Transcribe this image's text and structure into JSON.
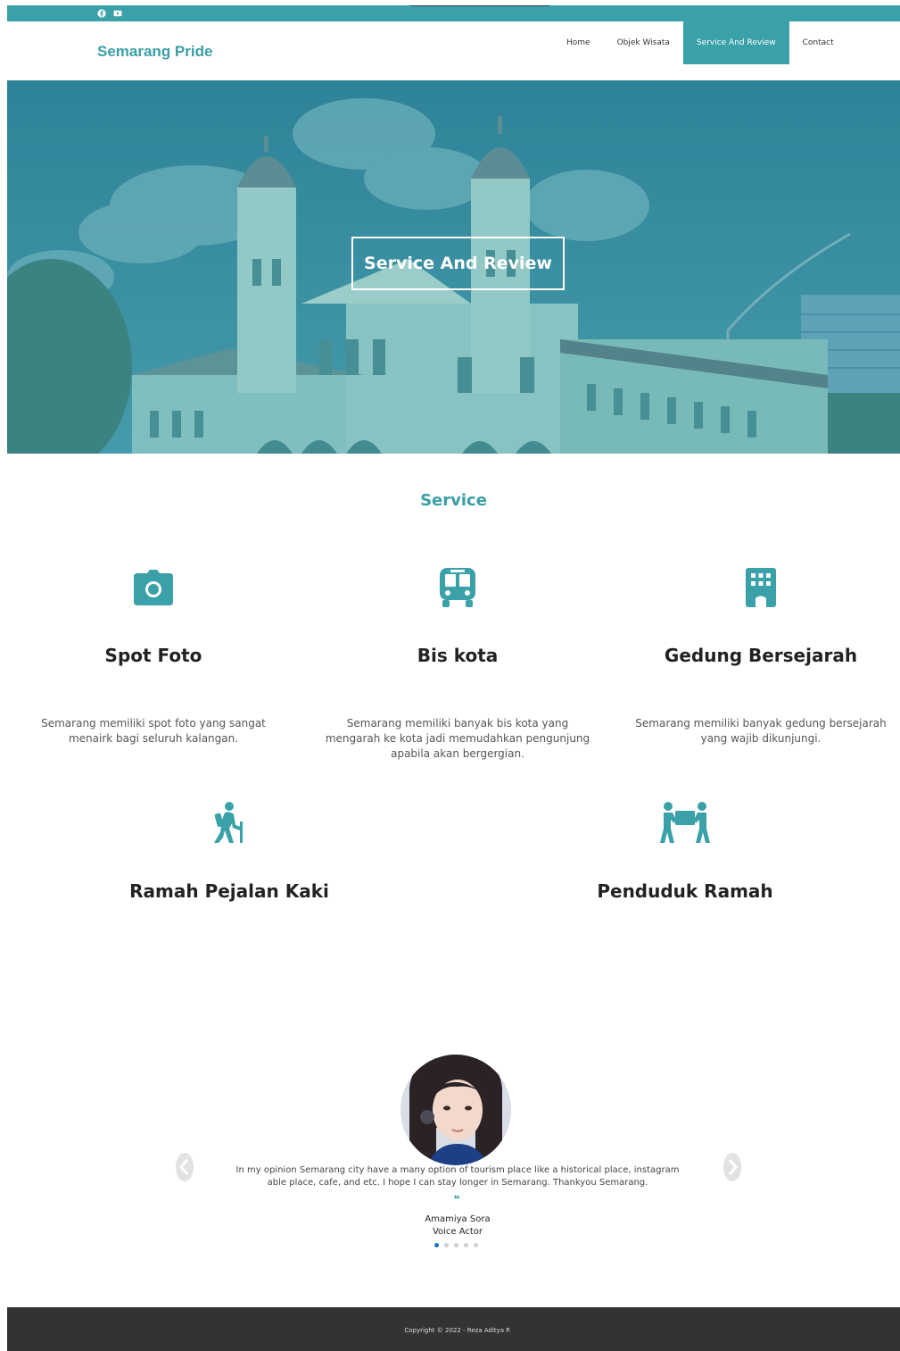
{
  "colors": {
    "accent": "#3aa1a8",
    "footer": "#333333",
    "dot_active": "#1e73c8"
  },
  "topbar": {
    "icons": [
      "facebook-icon",
      "youtube-icon"
    ]
  },
  "header": {
    "brand": "Semarang Pride",
    "nav": [
      {
        "label": "Home",
        "active": false
      },
      {
        "label": "Objek Wisata",
        "active": false
      },
      {
        "label": "Service And Review",
        "active": true
      },
      {
        "label": "Contact",
        "active": false
      }
    ]
  },
  "hero": {
    "title": "Service And Review"
  },
  "service": {
    "title": "Service",
    "items": [
      {
        "icon": "camera-icon",
        "title": "Spot Foto",
        "desc": "Semarang memiliki spot foto yang sangat menairk bagi seluruh kalangan."
      },
      {
        "icon": "bus-icon",
        "title": "Bis kota",
        "desc": "Semarang memiliki banyak bis kota yang mengarah ke kota jadi memudahkan pengunjung apabila akan bergergian."
      },
      {
        "icon": "building-icon",
        "title": "Gedung Bersejarah",
        "desc": "Semarang memiliki banyak gedung bersejarah yang wajib dikunjungi."
      },
      {
        "icon": "hiker-icon",
        "title": "Ramah Pejalan Kaki",
        "desc": ""
      },
      {
        "icon": "people-carry-icon",
        "title": "Penduduk Ramah",
        "desc": ""
      }
    ]
  },
  "testimonial": {
    "text": "In my opinion Semarang city have a many option of tourism place like a historical place, instagram able place, cafe, and etc. I hope I can stay longer in Semarang. Thankyou Semarang.",
    "quote_mark": "❝",
    "name": "Amamiya Sora",
    "role": "Voice Actor",
    "slides": 5,
    "active_slide": 1
  },
  "footer": {
    "copyright": "Copyright © 2022 - Reza Aditya P."
  }
}
